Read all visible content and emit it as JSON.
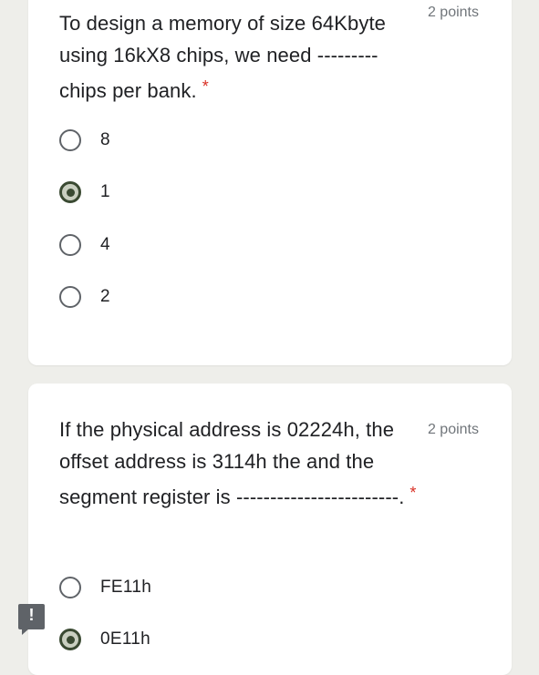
{
  "questions": [
    {
      "text": "To design a memory of size 64Kbyte using 16kX8 chips, we need --------- chips per bank.",
      "required_mark": "*",
      "points": "2 points",
      "options": [
        {
          "label": "8",
          "selected": false
        },
        {
          "label": "1",
          "selected": true
        },
        {
          "label": "4",
          "selected": false
        },
        {
          "label": "2",
          "selected": false
        }
      ]
    },
    {
      "text": "If the physical address is 02224h, the offset address is 3114h the and the segment register is ------------------------.",
      "required_mark": "*",
      "points": "2 points",
      "options": [
        {
          "label": "FE11h",
          "selected": false
        },
        {
          "label": "0E11h",
          "selected": true
        }
      ]
    }
  ],
  "feedback_button": {
    "icon": "exclamation-icon",
    "glyph": "!"
  },
  "colors": {
    "background": "#eeeeea",
    "card": "#ffffff",
    "required": "#d93025",
    "points": "#70757a",
    "radio_selected": "#3a4a32"
  }
}
